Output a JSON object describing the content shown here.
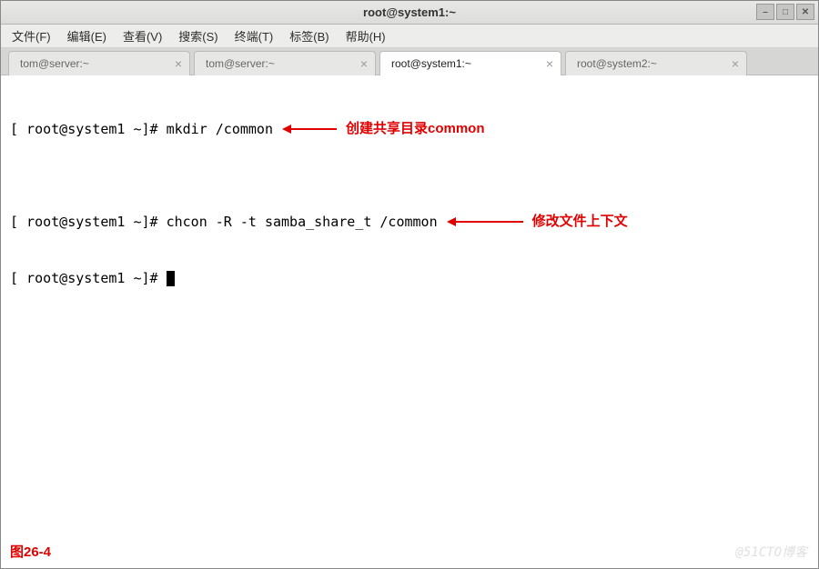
{
  "titlebar": {
    "title": "root@system1:~"
  },
  "menubar": {
    "items": [
      "文件(F)",
      "编辑(E)",
      "查看(V)",
      "搜索(S)",
      "终端(T)",
      "标签(B)",
      "帮助(H)"
    ]
  },
  "tabs": [
    {
      "label": "tom@server:~",
      "active": false
    },
    {
      "label": "tom@server:~",
      "active": false
    },
    {
      "label": "root@system1:~",
      "active": true
    },
    {
      "label": "root@system2:~",
      "active": false
    }
  ],
  "terminal": {
    "line1_prompt": "[ root@system1 ~]# ",
    "line1_cmd": "mkdir /common",
    "line1_annotation": "创建共享目录common",
    "line2_prompt": "[ root@system1 ~]# ",
    "line2_cmd": "chcon -R -t samba_share_t /common",
    "line2_annotation": "修改文件上下文",
    "line3_prompt": "[ root@system1 ~]# "
  },
  "figure_label": "图26-4",
  "watermark": "@51CTO博客"
}
